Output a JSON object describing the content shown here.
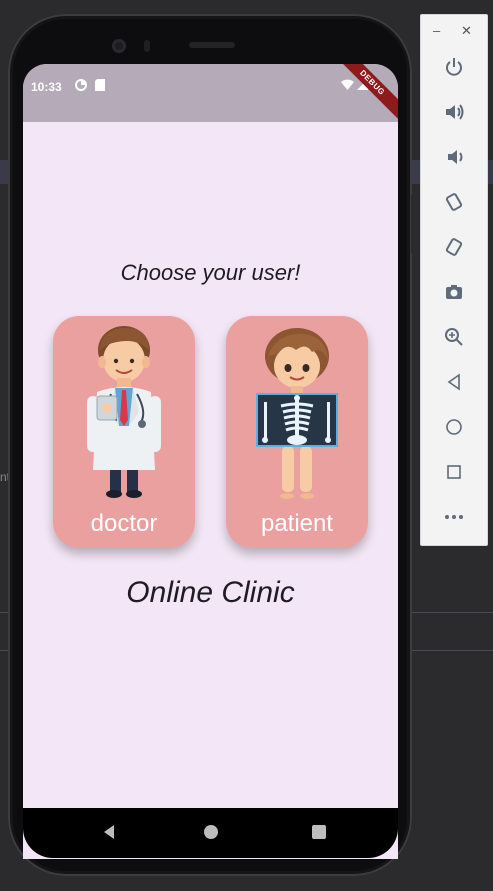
{
  "status_bar": {
    "time": "10:33",
    "debug_banner": "DEBUG"
  },
  "main": {
    "prompt": "Choose your user!",
    "cards": [
      {
        "label": "doctor"
      },
      {
        "label": "patient"
      }
    ],
    "brand_title": "Online Clinic"
  },
  "colors": {
    "background": "#f3e6f6",
    "status_bar": "#b5aab8",
    "card": "#eba0a0",
    "ribbon": "#8e1b1b"
  },
  "emulator_toolbar": {
    "minimize_icon": "minimize-icon",
    "close_icon": "close-icon",
    "buttons": [
      "power-icon",
      "volume-up-icon",
      "volume-down-icon",
      "rotate-left-icon",
      "rotate-right-icon",
      "camera-icon",
      "zoom-icon",
      "back-icon",
      "home-icon",
      "overview-icon",
      "more-icon"
    ]
  }
}
